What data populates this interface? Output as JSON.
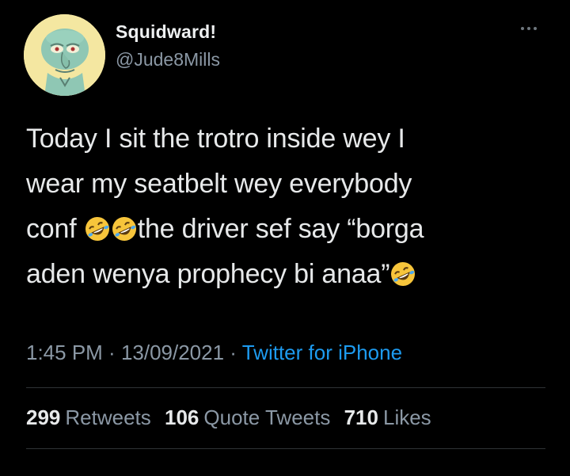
{
  "user": {
    "display_name": "Squidward!",
    "handle": "@Jude8Mills"
  },
  "tweet": {
    "line1": "Today I sit the trotro inside wey I",
    "line2": "wear my seatbelt wey everybody",
    "line3_a": "conf",
    "line3_b": "the driver sef say “borga",
    "line4": "aden wenya prophecy bi anaa”",
    "emoji": "rolling-on-the-floor-laughing"
  },
  "meta": {
    "time": "1:45 PM",
    "sep1": " · ",
    "date": "13/09/2021",
    "sep2": " · ",
    "source": "Twitter for iPhone"
  },
  "stats": {
    "retweets_count": "299",
    "retweets_label": "Retweets",
    "quotes_count": "106",
    "quotes_label": "Quote Tweets",
    "likes_count": "710",
    "likes_label": "Likes"
  },
  "colors": {
    "background": "#000000",
    "text": "#e7e9ea",
    "secondary": "#8b98a5",
    "link": "#1d9bf0",
    "divider": "#2f3336"
  }
}
